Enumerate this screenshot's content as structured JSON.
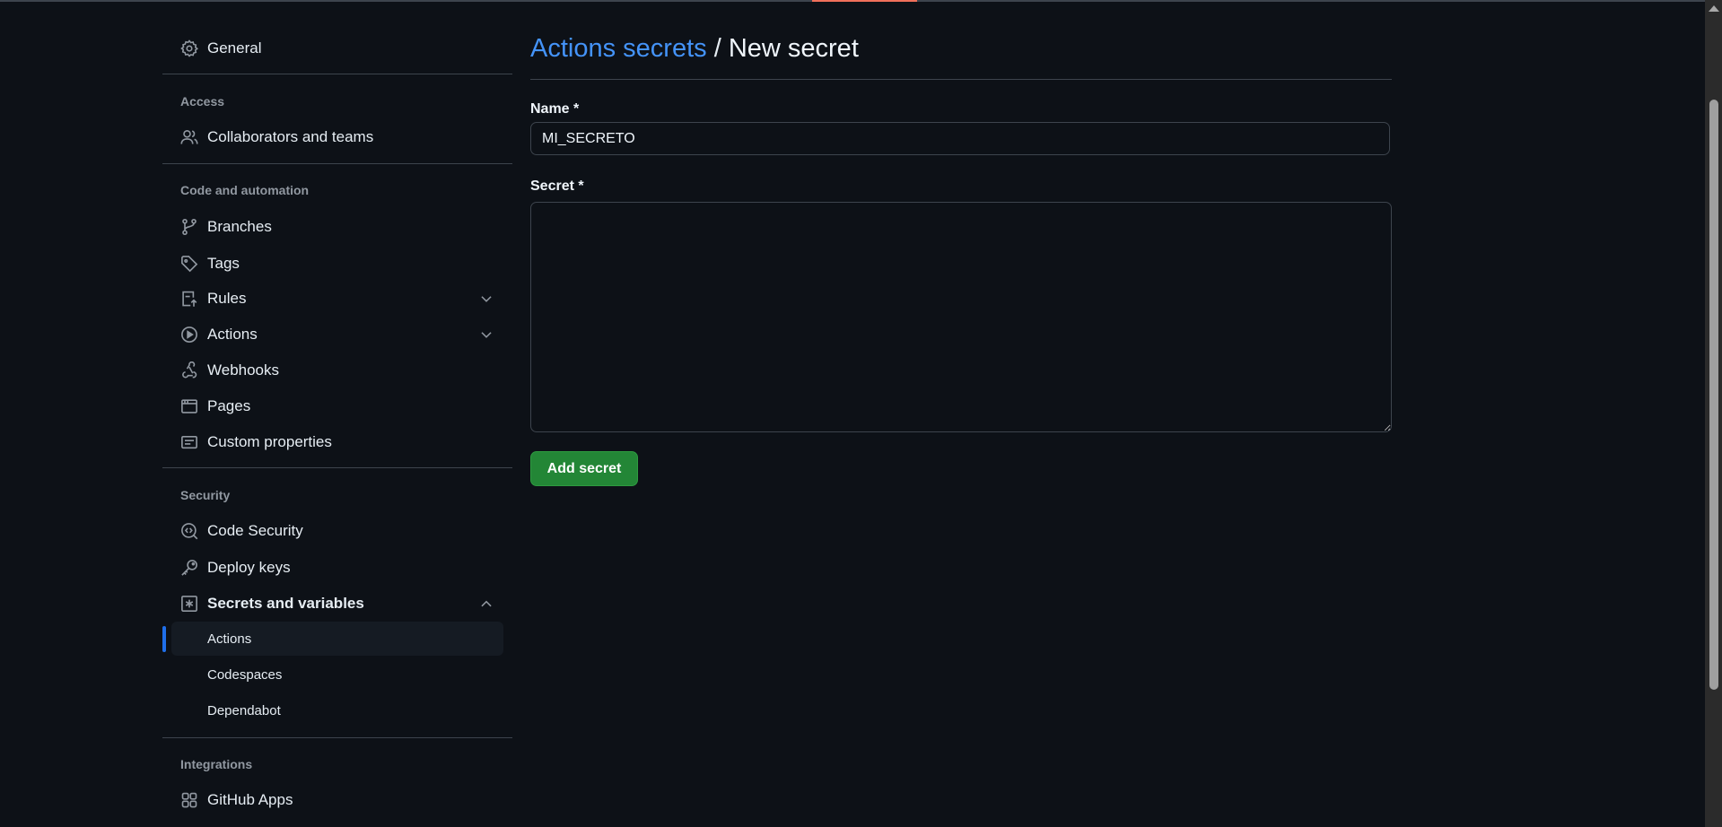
{
  "sidebar": {
    "general": "General",
    "sections": {
      "access": "Access",
      "code_automation": "Code and automation",
      "security": "Security",
      "integrations": "Integrations"
    },
    "items": {
      "collaborators": "Collaborators and teams",
      "branches": "Branches",
      "tags": "Tags",
      "rules": "Rules",
      "actions": "Actions",
      "webhooks": "Webhooks",
      "pages": "Pages",
      "custom_properties": "Custom properties",
      "code_security": "Code Security",
      "deploy_keys": "Deploy keys",
      "secrets_variables": "Secrets and variables",
      "sub_actions": "Actions",
      "sub_codespaces": "Codespaces",
      "sub_dependabot": "Dependabot",
      "github_apps": "GitHub Apps"
    }
  },
  "main": {
    "breadcrumb_link": "Actions secrets",
    "breadcrumb_sep": "/",
    "title": "New secret",
    "name_label": "Name *",
    "name_value": "MI_SECRETO",
    "secret_label": "Secret *",
    "secret_value": "",
    "submit": "Add secret"
  },
  "colors": {
    "accent": "#4493f8",
    "button": "#238636",
    "indicator": "#1f6feb"
  }
}
